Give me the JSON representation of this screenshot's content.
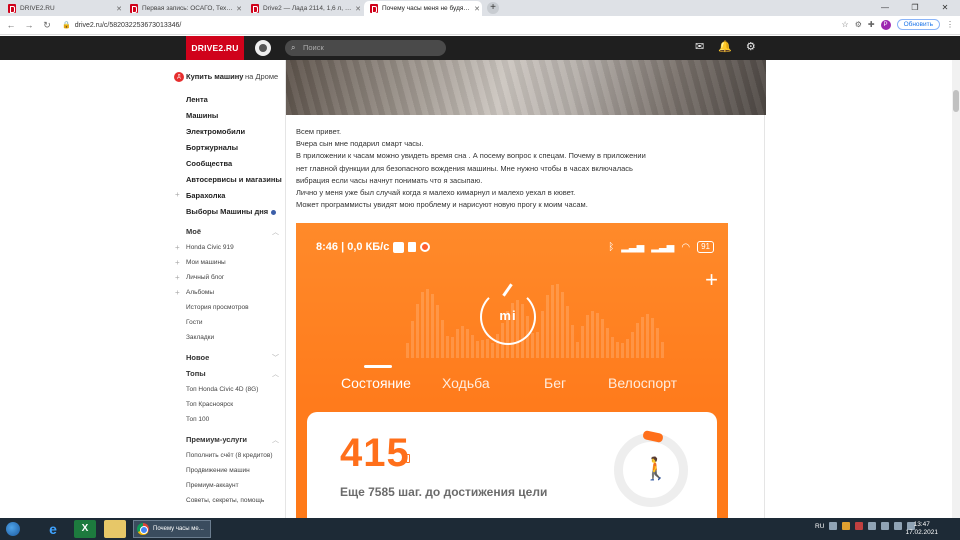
{
  "browser": {
    "tabs": [
      {
        "title": "DRIVE2.RU"
      },
      {
        "title": "Первая запись: ОСАГО, Техничи..."
      },
      {
        "title": "Drive2 — Лада 2114, 1,6 л, 2009 г..."
      },
      {
        "title": "Почему часы меня не будят за..."
      }
    ],
    "url": "drive2.ru/c/582032253673013346/",
    "profile_letter": "P",
    "update_label": "Обновить"
  },
  "site": {
    "logo": "DRIVE2.RU",
    "search_placeholder": "Поиск"
  },
  "sidebar": {
    "buy_car": "Купить машину",
    "buy_car_suffix": "на Дроме",
    "main_items": [
      "Лента",
      "Машины",
      "Электромобили",
      "Бортжурналы",
      "Сообщества",
      "Автосервисы и магазины",
      "Барахолка",
      "Выборы Машины дня"
    ],
    "mine_title": "Моё",
    "mine_items": [
      "Honda Civic 919",
      "Мои машины",
      "Личный блог",
      "Альбомы",
      "История просмотров",
      "Гости",
      "Закладки"
    ],
    "new_title": "Новое",
    "tops_title": "Топы",
    "tops_items": [
      "Топ Honda Civic 4D (8G)",
      "Топ Красноярск",
      "Топ 100"
    ],
    "premium_title": "Премиум-услуги",
    "premium_items": [
      "Пополнить счёт (8 кредитов)",
      "Продвижение машин",
      "Премиум-аккаунт",
      "Советы, секреты, помощь"
    ]
  },
  "post": {
    "lines": [
      "Всем привет.",
      "Вчера сын мне подарил смарт часы.",
      "В приложении к часам можно увидеть время сна . А посему вопрос к спецам. Почему в приложении",
      "нет главной функции для безопасного вождения машины. Мне нужно чтобы в часах включалась",
      "вибрация если часы начнут понимать что я засыпаю.",
      "Лично у меня уже был случай когда я малехо кимарнул и малехо уехал в кювет.",
      "Может программисты увидят мою проблему и нарисуют новую прогу к моим часам."
    ]
  },
  "phone": {
    "status_time": "8:46 | 0,0 КБ/с",
    "battery": "91",
    "logo": "mi",
    "tabs": [
      "Состояние",
      "Ходьба",
      "Бег",
      "Велоспорт"
    ],
    "steps": "415",
    "goal_text": "Еще 7585 шаг. до достижения цели"
  },
  "taskbar": {
    "chrome_title": "Почему часы ме...",
    "lang": "RU",
    "time": "13:47",
    "date": "17.02.2021"
  }
}
